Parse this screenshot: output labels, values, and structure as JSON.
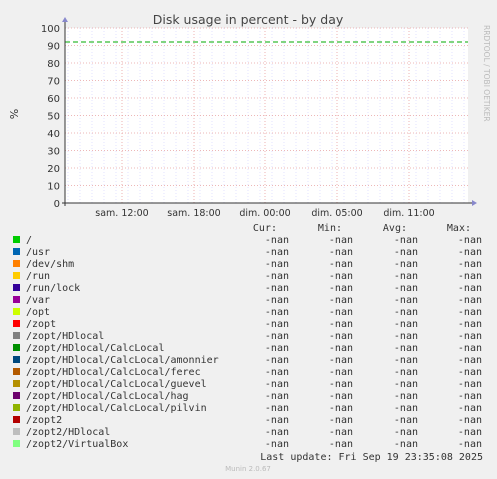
{
  "chart_data": {
    "type": "line",
    "title": "Disk usage in percent - by day",
    "ylabel": "%",
    "xlabel": "",
    "ylim": [
      0,
      100
    ],
    "y_ticks": [
      "0",
      "10",
      "20",
      "30",
      "40",
      "50",
      "60",
      "70",
      "80",
      "90",
      "100"
    ],
    "x_ticks": [
      "sam. 12:00",
      "sam. 18:00",
      "dim. 00:00",
      "dim. 05:00",
      "dim. 11:00"
    ],
    "grid": true,
    "warning_level": 92,
    "legend_columns": [
      "Cur:",
      "Min:",
      "Avg:",
      "Max:"
    ],
    "series": [
      {
        "name": "/",
        "color": "#00cc00",
        "cur": "-nan",
        "min": "-nan",
        "avg": "-nan",
        "max": "-nan"
      },
      {
        "name": "/usr",
        "color": "#0066b3",
        "cur": "-nan",
        "min": "-nan",
        "avg": "-nan",
        "max": "-nan"
      },
      {
        "name": "/dev/shm",
        "color": "#ff8000",
        "cur": "-nan",
        "min": "-nan",
        "avg": "-nan",
        "max": "-nan"
      },
      {
        "name": "/run",
        "color": "#ffcc00",
        "cur": "-nan",
        "min": "-nan",
        "avg": "-nan",
        "max": "-nan"
      },
      {
        "name": "/run/lock",
        "color": "#330099",
        "cur": "-nan",
        "min": "-nan",
        "avg": "-nan",
        "max": "-nan"
      },
      {
        "name": "/var",
        "color": "#990099",
        "cur": "-nan",
        "min": "-nan",
        "avg": "-nan",
        "max": "-nan"
      },
      {
        "name": "/opt",
        "color": "#ccff00",
        "cur": "-nan",
        "min": "-nan",
        "avg": "-nan",
        "max": "-nan"
      },
      {
        "name": "/zopt",
        "color": "#ff0000",
        "cur": "-nan",
        "min": "-nan",
        "avg": "-nan",
        "max": "-nan"
      },
      {
        "name": "/zopt/HDlocal",
        "color": "#808080",
        "cur": "-nan",
        "min": "-nan",
        "avg": "-nan",
        "max": "-nan"
      },
      {
        "name": "/zopt/HDlocal/CalcLocal",
        "color": "#008f00",
        "cur": "-nan",
        "min": "-nan",
        "avg": "-nan",
        "max": "-nan"
      },
      {
        "name": "/zopt/HDlocal/CalcLocal/amonnier",
        "color": "#00487d",
        "cur": "-nan",
        "min": "-nan",
        "avg": "-nan",
        "max": "-nan"
      },
      {
        "name": "/zopt/HDlocal/CalcLocal/ferec",
        "color": "#b35a00",
        "cur": "-nan",
        "min": "-nan",
        "avg": "-nan",
        "max": "-nan"
      },
      {
        "name": "/zopt/HDlocal/CalcLocal/guevel",
        "color": "#b38f00",
        "cur": "-nan",
        "min": "-nan",
        "avg": "-nan",
        "max": "-nan"
      },
      {
        "name": "/zopt/HDlocal/CalcLocal/hag",
        "color": "#6b006b",
        "cur": "-nan",
        "min": "-nan",
        "avg": "-nan",
        "max": "-nan"
      },
      {
        "name": "/zopt/HDlocal/CalcLocal/pilvin",
        "color": "#8fb300",
        "cur": "-nan",
        "min": "-nan",
        "avg": "-nan",
        "max": "-nan"
      },
      {
        "name": "/zopt2",
        "color": "#b30000",
        "cur": "-nan",
        "min": "-nan",
        "avg": "-nan",
        "max": "-nan"
      },
      {
        "name": "/zopt2/HDlocal",
        "color": "#bebebe",
        "cur": "-nan",
        "min": "-nan",
        "avg": "-nan",
        "max": "-nan"
      },
      {
        "name": "/zopt2/VirtualBox",
        "color": "#80ff80",
        "cur": "-nan",
        "min": "-nan",
        "avg": "-nan",
        "max": "-nan"
      }
    ],
    "last_update": "Last update: Fri Sep 19 23:35:08 2025",
    "side_label": "RRDTOOL / TOBI OETIKER",
    "footer": "Munin 2.0.67"
  },
  "colors": {
    "background": "#f0f0f0",
    "plot_background": "#ffffff",
    "major_grid": "#e8a0a0",
    "minor_grid": "#d0d0ff",
    "warning_line": "#00aa00",
    "text": "#333333"
  }
}
